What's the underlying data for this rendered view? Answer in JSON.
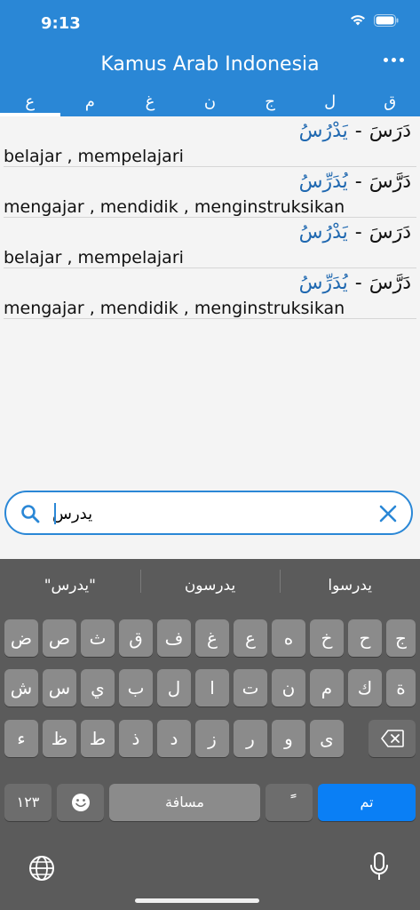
{
  "status": {
    "time": "9:13"
  },
  "header": {
    "title": "Kamus Arab Indonesia"
  },
  "tabs": [
    {
      "label": "ع",
      "active": true
    },
    {
      "label": "م",
      "active": false
    },
    {
      "label": "غ",
      "active": false
    },
    {
      "label": "ن",
      "active": false
    },
    {
      "label": "ج",
      "active": false
    },
    {
      "label": "ل",
      "active": false
    },
    {
      "label": "ق",
      "active": false
    }
  ],
  "entries": [
    {
      "past": "دَرَسَ",
      "dash": "-",
      "imperfect": "يَدْرُسُ",
      "meaning": "belajar , mempelajari"
    },
    {
      "past": "دَرَّسَ",
      "dash": "-",
      "imperfect": "يُدَرِّسُ",
      "meaning": "mengajar , mendidik , menginstruksikan"
    },
    {
      "past": "دَرَسَ",
      "dash": "-",
      "imperfect": "يَدْرُسُ",
      "meaning": "belajar , mempelajari"
    },
    {
      "past": "دَرَّسَ",
      "dash": "-",
      "imperfect": "يُدَرِّسُ",
      "meaning": "mengajar , mendidik , menginstruksikan"
    }
  ],
  "search": {
    "value": "يدرس"
  },
  "keyboard": {
    "suggestions": [
      "\"يدرس\"",
      "يدرسون",
      "يدرسوا"
    ],
    "row1": [
      "ض",
      "ص",
      "ث",
      "ق",
      "ف",
      "غ",
      "ع",
      "ه",
      "خ",
      "ح",
      "ج"
    ],
    "row2": [
      "ش",
      "س",
      "ي",
      "ب",
      "ل",
      "ا",
      "ت",
      "ن",
      "م",
      "ك",
      "ة"
    ],
    "row3": [
      "ء",
      "ظ",
      "ط",
      "ذ",
      "د",
      "ز",
      "ر",
      "و",
      "ى"
    ],
    "numbers_label": "١٢٣",
    "space_label": "مسافة",
    "tanween_label": "ًً",
    "done_label": "تم"
  },
  "colors": {
    "accent": "#2a87d6",
    "imperfect": "#1f68b0",
    "done": "#0a7ff5"
  }
}
